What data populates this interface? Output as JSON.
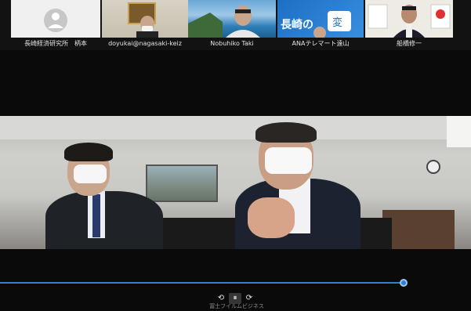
{
  "participants": [
    {
      "name": "長崎経済研究所　柄本",
      "video": "avatar-placeholder"
    },
    {
      "name": "doyukai@nagasaki-keiz",
      "video": "camera"
    },
    {
      "name": "Nobuhiko Taki",
      "video": "camera"
    },
    {
      "name": "ANAテレマート遠山",
      "video": "camera"
    },
    {
      "name": "船橋修一",
      "video": "camera"
    }
  ],
  "tile4_sign": "長崎の",
  "tile4_glyph": "変",
  "playback": {
    "progress": 0.857
  },
  "controls": {
    "prev_icon": "rewind-icon",
    "pause_icon": "pause-icon",
    "next_icon": "forward-icon",
    "prev": "⟲",
    "pause": "⏸",
    "next": "⟳"
  },
  "caption": "冨士フイルムビジネス",
  "colors": {
    "accent": "#2f7fd6",
    "background": "#0a0a0a"
  }
}
